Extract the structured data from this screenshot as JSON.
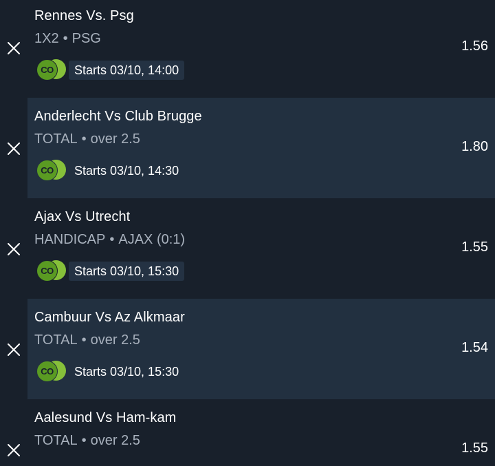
{
  "bets": [
    {
      "match": "Rennes Vs. Psg",
      "market": "1X2",
      "selection": "PSG",
      "separator": "•",
      "brand_icon": "CO",
      "starts": "Starts 03/10, 14:00",
      "odds": "1.56"
    },
    {
      "match": "Anderlecht Vs Club Brugge",
      "market": "TOTAL",
      "selection": "over 2.5",
      "separator": "•",
      "brand_icon": "CO",
      "starts": "Starts 03/10, 14:30",
      "odds": "1.80"
    },
    {
      "match": "Ajax Vs Utrecht",
      "market": "HANDICAP",
      "selection": "AJAX (0:1)",
      "separator": "•",
      "brand_icon": "CO",
      "starts": "Starts 03/10, 15:30",
      "odds": "1.55"
    },
    {
      "match": "Cambuur Vs Az Alkmaar",
      "market": "TOTAL",
      "selection": "over 2.5",
      "separator": "•",
      "brand_icon": "CO",
      "starts": "Starts 03/10, 15:30",
      "odds": "1.54"
    },
    {
      "match": "Aalesund Vs Ham-kam",
      "market": "TOTAL",
      "selection": "over 2.5",
      "separator": "•",
      "odds": "1.55"
    }
  ],
  "icons": {
    "remove": "close-icon",
    "brand": "brand-logo-icon"
  },
  "colors": {
    "background": "#18202b",
    "alt_row": "#223040",
    "brand_green": "#5a9b22",
    "brand_green_light": "#86c03a",
    "muted_text": "#a8b1bd"
  }
}
